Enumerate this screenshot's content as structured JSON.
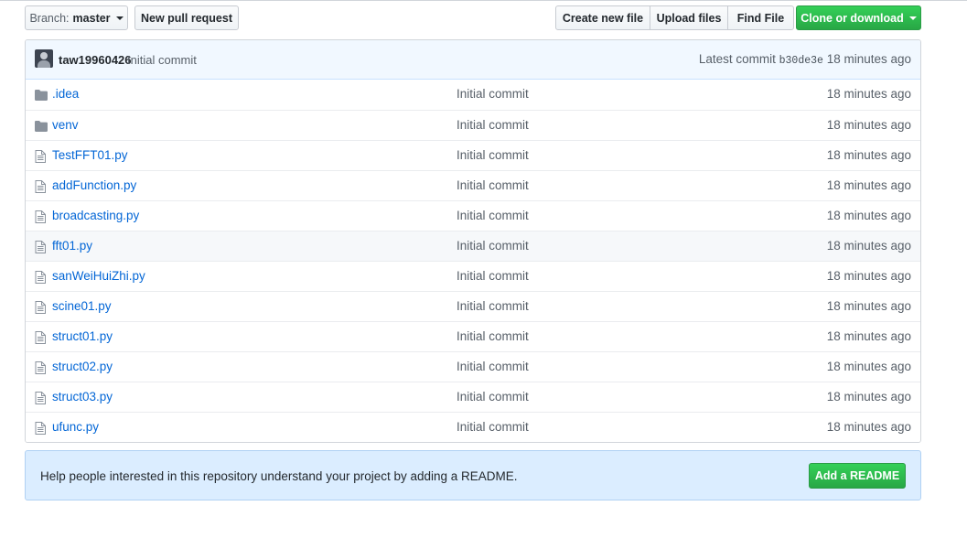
{
  "toolbar": {
    "branch_prefix": "Branch:",
    "branch_name": "master",
    "new_pr_label": "New pull request",
    "create_file_label": "Create new file",
    "upload_files_label": "Upload files",
    "find_file_label": "Find File",
    "clone_label": "Clone or download"
  },
  "commit": {
    "author": "taw19960426",
    "message": "Initial commit",
    "latest_label": "Latest commit",
    "sha": "b30de3e",
    "age": "18 minutes ago"
  },
  "files": [
    {
      "name": ".idea",
      "type": "folder",
      "message": "Initial commit",
      "age": "18 minutes ago"
    },
    {
      "name": "venv",
      "type": "folder",
      "message": "Initial commit",
      "age": "18 minutes ago"
    },
    {
      "name": "TestFFT01.py",
      "type": "file",
      "message": "Initial commit",
      "age": "18 minutes ago"
    },
    {
      "name": "addFunction.py",
      "type": "file",
      "message": "Initial commit",
      "age": "18 minutes ago"
    },
    {
      "name": "broadcasting.py",
      "type": "file",
      "message": "Initial commit",
      "age": "18 minutes ago"
    },
    {
      "name": "fft01.py",
      "type": "file",
      "message": "Initial commit",
      "age": "18 minutes ago"
    },
    {
      "name": "sanWeiHuiZhi.py",
      "type": "file",
      "message": "Initial commit",
      "age": "18 minutes ago"
    },
    {
      "name": "scine01.py",
      "type": "file",
      "message": "Initial commit",
      "age": "18 minutes ago"
    },
    {
      "name": "struct01.py",
      "type": "file",
      "message": "Initial commit",
      "age": "18 minutes ago"
    },
    {
      "name": "struct02.py",
      "type": "file",
      "message": "Initial commit",
      "age": "18 minutes ago"
    },
    {
      "name": "struct03.py",
      "type": "file",
      "message": "Initial commit",
      "age": "18 minutes ago"
    },
    {
      "name": "ufunc.py",
      "type": "file",
      "message": "Initial commit",
      "age": "18 minutes ago"
    }
  ],
  "readme": {
    "prompt": "Help people interested in this repository understand your project by adding a README.",
    "button_label": "Add a README"
  },
  "colors": {
    "link": "#0366d6",
    "green_button": "#28a745",
    "commit_bar": "#f1f8ff",
    "readme_bg": "#dbedff",
    "icon": "#79b8ff"
  },
  "icons": {
    "folder": "folder-icon",
    "file": "file-icon",
    "caret": "caret-down-icon"
  }
}
